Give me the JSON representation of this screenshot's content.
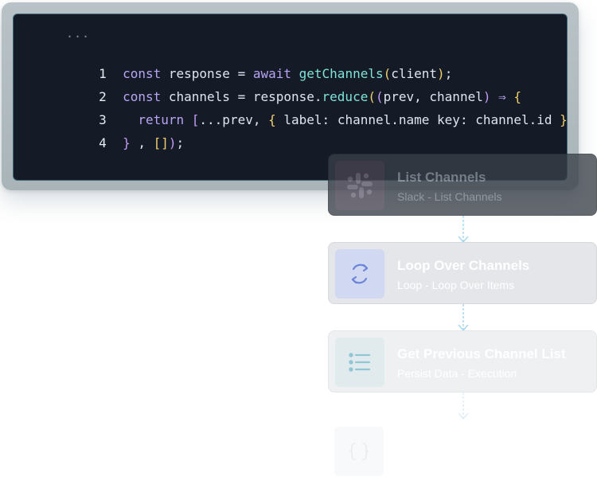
{
  "code": {
    "ellipsis": "...",
    "lines": [
      {
        "number": "1",
        "tokens": [
          {
            "t": "const",
            "c": "kw"
          },
          {
            "t": " response = ",
            "c": "plain"
          },
          {
            "t": "await",
            "c": "kw"
          },
          {
            "t": " ",
            "c": "plain"
          },
          {
            "t": "getChannels",
            "c": "fn"
          },
          {
            "t": "(",
            "c": "bracket"
          },
          {
            "t": "client",
            "c": "plain"
          },
          {
            "t": ")",
            "c": "bracket"
          },
          {
            "t": ";",
            "c": "plain"
          }
        ]
      },
      {
        "number": "2",
        "tokens": [
          {
            "t": "const",
            "c": "kw"
          },
          {
            "t": " channels = response.",
            "c": "plain"
          },
          {
            "t": "reduce",
            "c": "fn"
          },
          {
            "t": "(",
            "c": "bracket"
          },
          {
            "t": "(",
            "c": "bracket2"
          },
          {
            "t": "prev, channel",
            "c": "plain"
          },
          {
            "t": ")",
            "c": "bracket2"
          },
          {
            "t": " ⇒ ",
            "c": "op"
          },
          {
            "t": "{",
            "c": "bracket"
          }
        ]
      },
      {
        "number": "3",
        "tokens": [
          {
            "t": "  ",
            "c": "plain"
          },
          {
            "t": "return",
            "c": "kw"
          },
          {
            "t": " ",
            "c": "plain"
          },
          {
            "t": "[",
            "c": "bracket2"
          },
          {
            "t": "...prev, ",
            "c": "plain"
          },
          {
            "t": "{",
            "c": "bracket"
          },
          {
            "t": " label: channel.name key: channel.id ",
            "c": "plain"
          },
          {
            "t": "}",
            "c": "bracket"
          },
          {
            "t": "]",
            "c": "bracket2"
          }
        ]
      },
      {
        "number": "4",
        "tokens": [
          {
            "t": "}",
            "c": "bracket2"
          },
          {
            "t": " , ",
            "c": "plain"
          },
          {
            "t": "[]",
            "c": "bracket"
          },
          {
            "t": ")",
            "c": "bracket2"
          },
          {
            "t": ";",
            "c": "plain"
          }
        ]
      }
    ]
  },
  "workflow": {
    "steps": [
      {
        "title": "List Channels",
        "subtitle": "Slack - List Channels",
        "icon": "slack-icon"
      },
      {
        "title": "Loop Over Channels",
        "subtitle": "Loop - Loop Over Items",
        "icon": "loop-arrows-icon"
      },
      {
        "title": "Get Previous Channel List",
        "subtitle": "Persist Data - Execution",
        "icon": "list-icon"
      },
      {
        "title": "",
        "subtitle": "",
        "icon": "code-braces-icon"
      }
    ]
  },
  "colors": {
    "editor_bg": "#141b27",
    "editor_frame": "#b9c3c7",
    "keyword": "#b8a4f3",
    "function": "#7fe3d8",
    "bracket": "#f1cf6d",
    "connector": "#9fd4ec",
    "loop_icon": "#6e86d8",
    "list_icon": "#8cc4d2"
  }
}
